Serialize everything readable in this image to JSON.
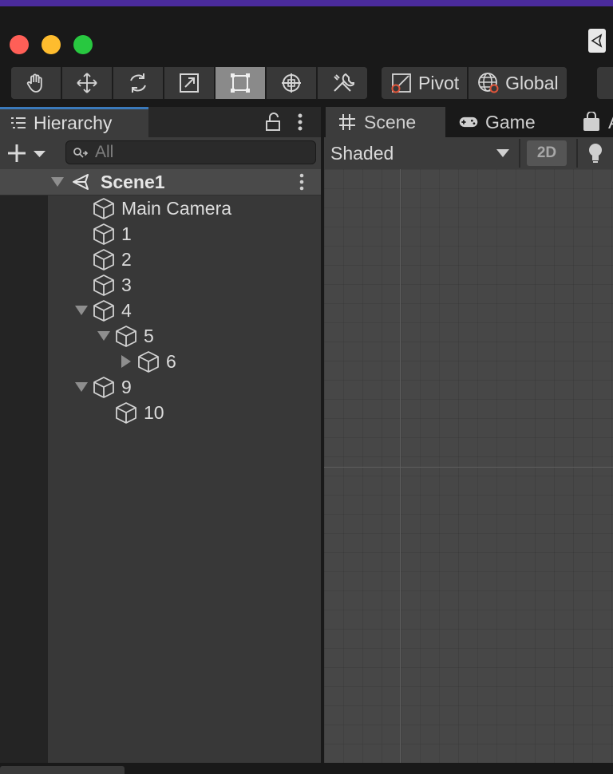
{
  "toolbar": {
    "tools": [
      "hand-tool",
      "move-tool",
      "rotate-tool",
      "scale-tool",
      "rect-tool",
      "transform-tool",
      "custom-editor-tool"
    ],
    "active_tool": "rect-tool",
    "pivot_label": "Pivot",
    "global_label": "Global"
  },
  "hierarchy": {
    "tab_label": "Hierarchy",
    "search_placeholder": "All",
    "scene_name": "Scene1",
    "items": [
      {
        "label": "Main Camera"
      },
      {
        "label": "1"
      },
      {
        "label": "2"
      },
      {
        "label": "3"
      },
      {
        "label": "4",
        "expanded": true
      },
      {
        "label": "5",
        "expanded": true
      },
      {
        "label": "6",
        "expanded": false
      },
      {
        "label": "9",
        "expanded": true
      },
      {
        "label": "10"
      }
    ]
  },
  "scene_view": {
    "tabs": [
      {
        "label": "Scene"
      },
      {
        "label": "Game"
      },
      {
        "label": "A"
      }
    ],
    "shading_mode": "Shaded",
    "mode_2d_label": "2D"
  },
  "colors": {
    "selection_accent": "#3a79bb",
    "pivot_accent": "#e0553a",
    "close": "#ff5f57",
    "minimize": "#febc2e",
    "zoom": "#28c840"
  }
}
